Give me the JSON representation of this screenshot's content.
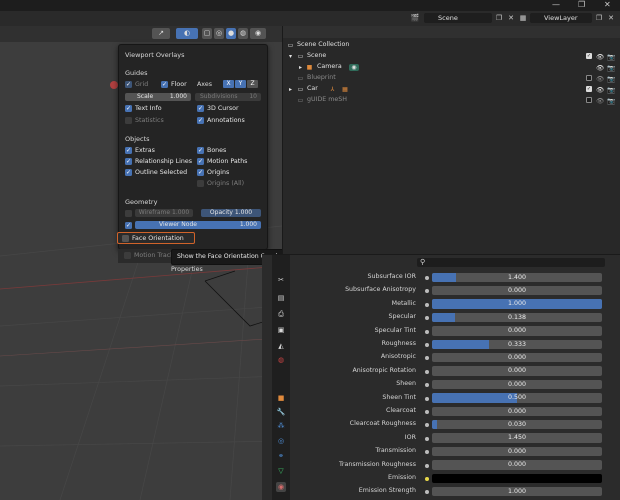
{
  "window": {
    "controls": [
      "—",
      "❐",
      "✕"
    ]
  },
  "top_fields": {
    "scene": "Scene",
    "view_layer": "ViewLayer"
  },
  "overlays": {
    "title": "Viewport Overlays",
    "guides": {
      "header": "Guides",
      "grid": "Grid",
      "floor": "Floor",
      "axes": "Axes",
      "axis_x": "X",
      "axis_y": "Y",
      "axis_z": "Z",
      "scale_label": "Scale",
      "scale_value": "1.000",
      "subdivisions_label": "Subdivisions",
      "subdivisions_value": "10",
      "text_info": "Text Info",
      "cursor_3d": "3D Cursor",
      "statistics": "Statistics",
      "annotations": "Annotations"
    },
    "objects": {
      "header": "Objects",
      "extras": "Extras",
      "bones": "Bones",
      "relationship_lines": "Relationship Lines",
      "motion_paths": "Motion Paths",
      "outline_selected": "Outline Selected",
      "origins": "Origins",
      "origins_all": "Origins (All)"
    },
    "geometry": {
      "header": "Geometry",
      "wireframe_label": "Wireframe",
      "wireframe_value": "1.000",
      "opacity_label": "Opacity",
      "opacity_value": "1.000",
      "viewer_node_label": "Viewer Node",
      "viewer_node_value": "1.000",
      "face_orientation": "Face Orientation"
    },
    "motion_tracking": "Motion Tracking",
    "tooltip": "Show the Face Orientation Overlay.",
    "properties_label": "Properties"
  },
  "outliner": {
    "items": [
      {
        "label": "Scene Collection",
        "dim": false
      },
      {
        "label": "Scene",
        "dim": false
      },
      {
        "label": "Camera",
        "dim": false
      },
      {
        "label": "Blueprint",
        "dim": true
      },
      {
        "label": "Car",
        "dim": false
      },
      {
        "label": "gUIDE meSH",
        "dim": true
      }
    ]
  },
  "properties": {
    "rows": [
      {
        "label": "Subsurface IOR",
        "value": "1.400",
        "fill": 0.14
      },
      {
        "label": "Subsurface Anisotropy",
        "value": "0.000",
        "fill": 0
      },
      {
        "label": "Metallic",
        "value": "1.000",
        "fill": 1.0
      },
      {
        "label": "Specular",
        "value": "0.138",
        "fill": 0.138
      },
      {
        "label": "Specular Tint",
        "value": "0.000",
        "fill": 0
      },
      {
        "label": "Roughness",
        "value": "0.333",
        "fill": 0.333
      },
      {
        "label": "Anisotropic",
        "value": "0.000",
        "fill": 0
      },
      {
        "label": "Anisotropic Rotation",
        "value": "0.000",
        "fill": 0
      },
      {
        "label": "Sheen",
        "value": "0.000",
        "fill": 0
      },
      {
        "label": "Sheen Tint",
        "value": "0.500",
        "fill": 0.5
      },
      {
        "label": "Clearcoat",
        "value": "0.000",
        "fill": 0
      },
      {
        "label": "Clearcoat Roughness",
        "value": "0.030",
        "fill": 0.03
      },
      {
        "label": "IOR",
        "value": "1.450",
        "fill": 0
      },
      {
        "label": "Transmission",
        "value": "0.000",
        "fill": 0
      },
      {
        "label": "Transmission Roughness",
        "value": "0.000",
        "fill": 0
      },
      {
        "label": "Emission",
        "value": "",
        "fill": 0,
        "color": "#000000"
      },
      {
        "label": "Emission Strength",
        "value": "1.000",
        "fill": 0
      }
    ]
  },
  "colors": {
    "accent": "#4772b3",
    "highlight": "#d0632a",
    "emission_dot": "#e8d84a"
  }
}
